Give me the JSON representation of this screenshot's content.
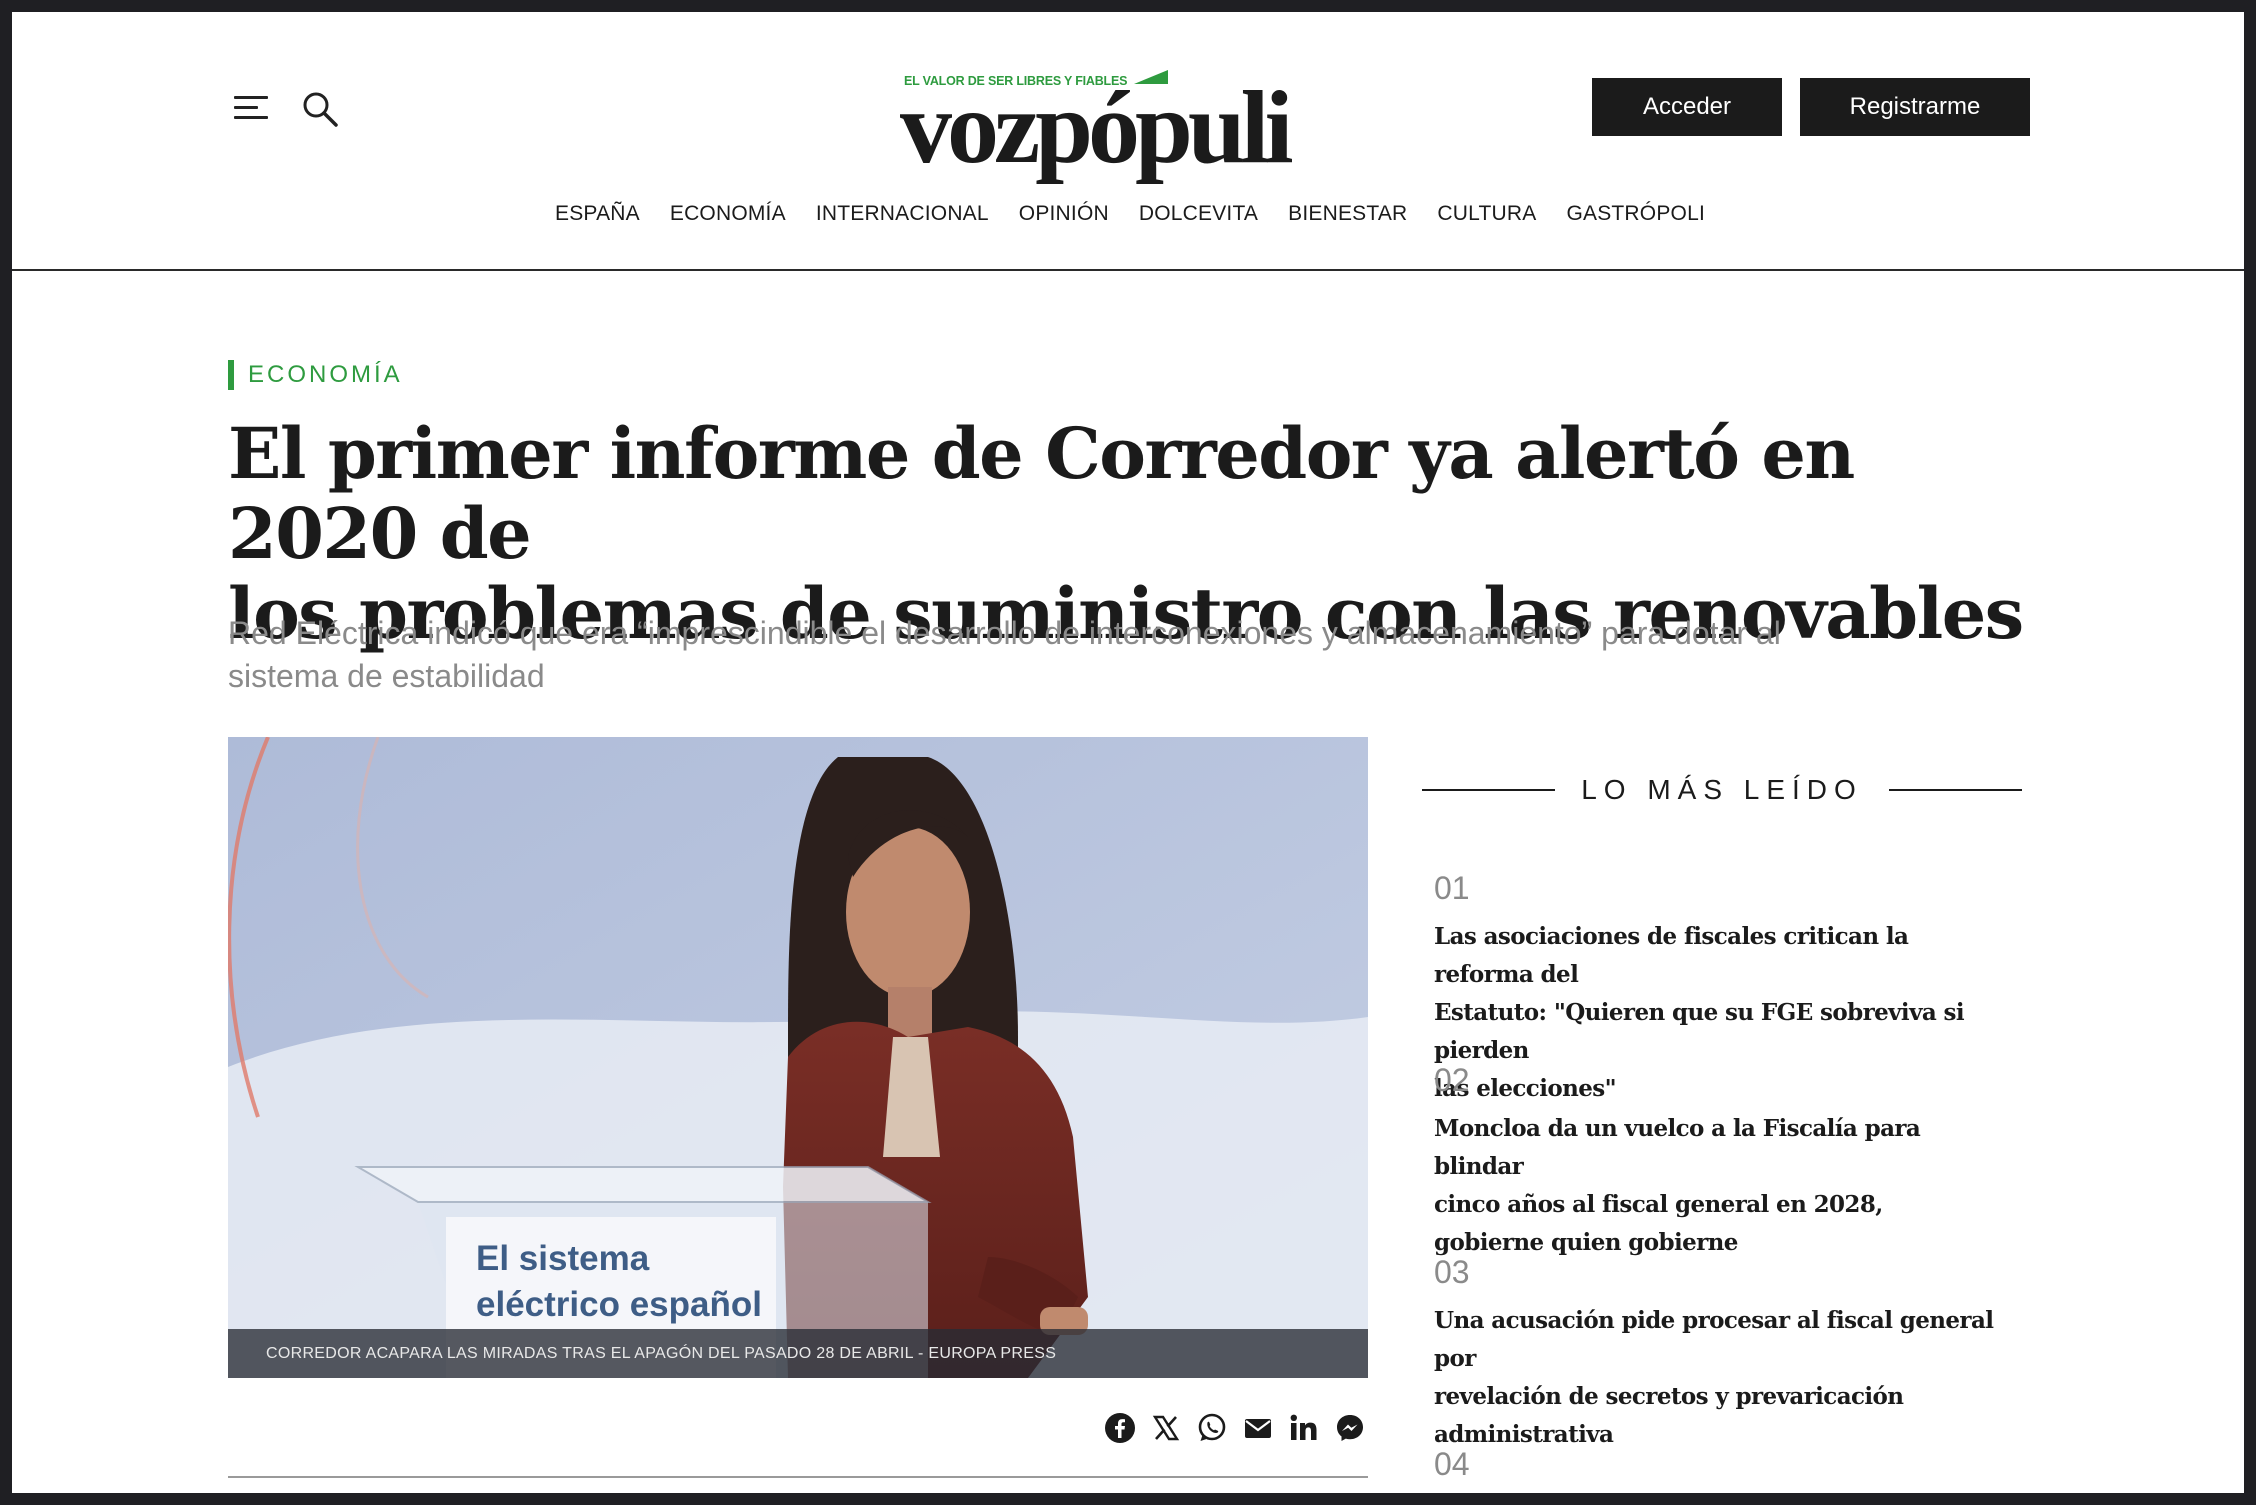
{
  "header": {
    "logo_tagline": "EL VALOR DE SER LIBRES Y FIABLES",
    "logo_word": "vozpópuli",
    "login_label": "Acceder",
    "register_label": "Registrarme",
    "nav": [
      "ESPAÑA",
      "ECONOMÍA",
      "INTERNACIONAL",
      "OPINIÓN",
      "DOLCEVITA",
      "BIENESTAR",
      "CULTURA",
      "GASTRÓPOLI"
    ]
  },
  "article": {
    "section": "ECONOMÍA",
    "headline_line1": "El primer informe de Corredor ya alertó en 2020 de",
    "headline_line2": "los problemas de suministro con las renovables",
    "subtitle_line1": "Red Eléctrica indicó que era “imprescindible el desarrollo de interconexiones y almacenamiento” para dotar al",
    "subtitle_line2": "sistema de estabilidad",
    "photo": {
      "caption": "CORREDOR ACAPARA LAS MIRADAS TRAS EL APAGÓN DEL PASADO 28 DE ABRIL - EUROPA PRESS",
      "podium_line1": "El sistema",
      "podium_line2": "eléctrico español"
    },
    "share_icons": [
      "facebook-icon",
      "x-icon",
      "whatsapp-icon",
      "email-icon",
      "linkedin-icon",
      "messenger-icon"
    ]
  },
  "most_read": {
    "title": "LO MÁS LEÍDO",
    "items": [
      {
        "num": "01",
        "lines": [
          "Las asociaciones de fiscales critican la reforma del",
          "Estatuto: \"Quieren que su FGE sobreviva si pierden",
          "las elecciones\""
        ]
      },
      {
        "num": "02",
        "lines": [
          "Moncloa da un vuelco a la Fiscalía para blindar",
          "cinco años al fiscal general en 2028,",
          "gobierne quien gobierne"
        ]
      },
      {
        "num": "03",
        "lines": [
          "Una acusación pide procesar al fiscal general por",
          "revelación de secretos y prevaricación",
          "administrativa"
        ]
      },
      {
        "num": "04",
        "lines": []
      }
    ]
  },
  "colors": {
    "brand_green": "#2e9b3f",
    "text_dark": "#1b1b1b",
    "subtitle_gray": "#8a8a8a"
  }
}
